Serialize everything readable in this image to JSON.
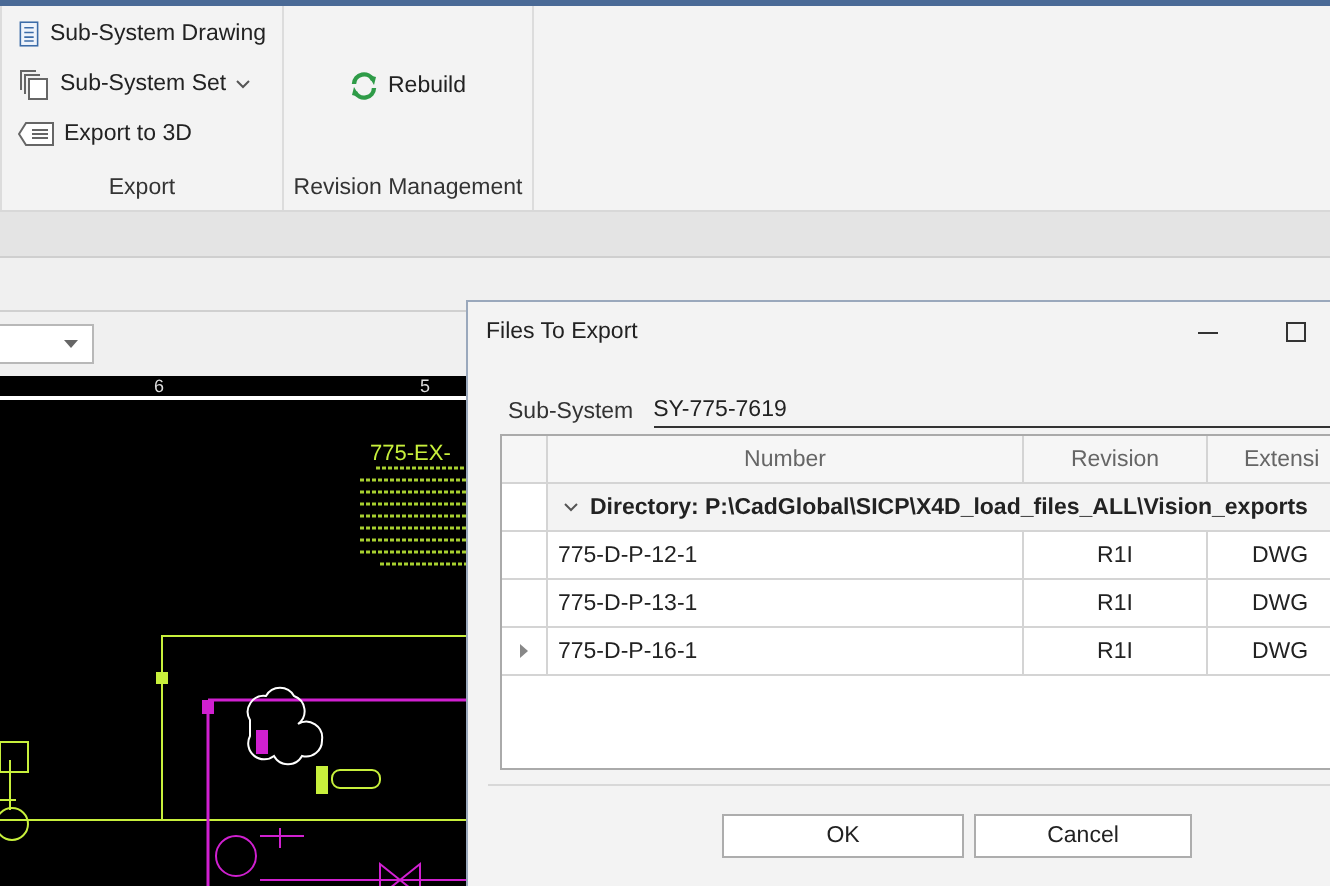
{
  "ribbon": {
    "groups": [
      {
        "label": "Export",
        "items": [
          {
            "label": "Sub-System Drawing",
            "kind": "document",
            "has_menu": false
          },
          {
            "label": "Sub-System Set",
            "kind": "pages",
            "has_menu": true
          },
          {
            "label": "Export to 3D",
            "kind": "export",
            "has_menu": false
          }
        ]
      },
      {
        "label": "Revision Management",
        "items": [
          {
            "label": "Rebuild",
            "kind": "refresh",
            "has_menu": false
          }
        ]
      }
    ]
  },
  "ruler": {
    "labels": [
      "6",
      "5"
    ]
  },
  "drawing": {
    "title": "775-EX-"
  },
  "dialog": {
    "title": "Files To Export",
    "sub_system": {
      "label": "Sub-System",
      "value": "SY-775-7619"
    },
    "table": {
      "columns": [
        "Number",
        "Revision",
        "Extensi"
      ],
      "group": {
        "label": "Directory: P:\\CadGlobal\\SICP\\X4D_load_files_ALL\\Vision_exports",
        "expanded": true
      },
      "rows": [
        {
          "number": "775-D-P-12-1",
          "revision": "R1I",
          "extension": "DWG",
          "current": false
        },
        {
          "number": "775-D-P-13-1",
          "revision": "R1I",
          "extension": "DWG",
          "current": false
        },
        {
          "number": "775-D-P-16-1",
          "revision": "R1I",
          "extension": "DWG",
          "current": true
        }
      ]
    },
    "buttons": [
      "OK",
      "Cancel"
    ]
  }
}
